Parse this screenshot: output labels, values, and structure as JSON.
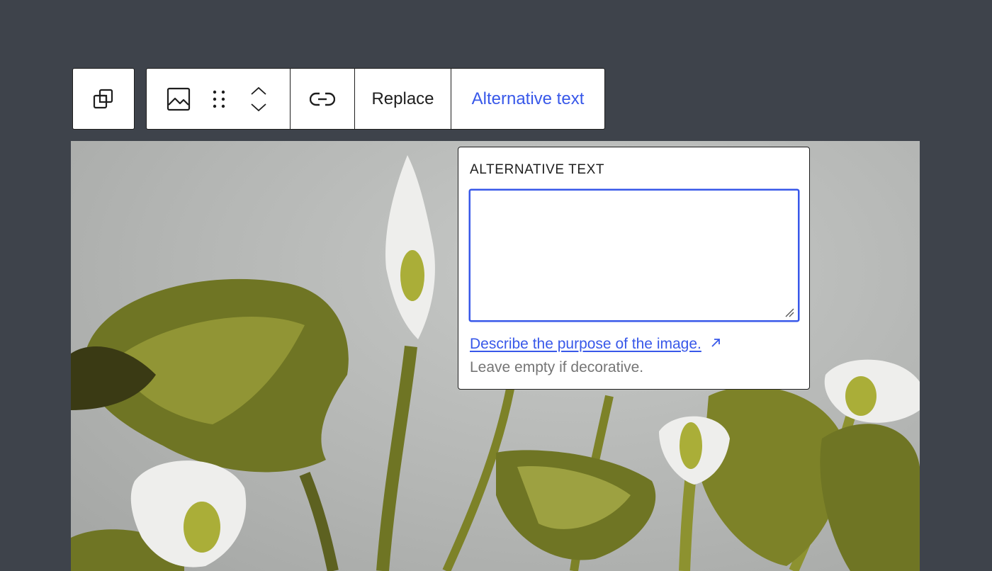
{
  "toolbar": {
    "groups": [
      {
        "buttons": [
          {
            "icon": "duplicate-blocks-icon"
          }
        ]
      },
      {
        "buttons": [
          {
            "icon": "image-icon"
          },
          {
            "icon": "drag-handle-icon"
          },
          {
            "icon": "move-up-down-icon"
          },
          {
            "icon": "link-icon"
          },
          {
            "label": "Replace"
          },
          {
            "label": "Alternative text",
            "active": true
          }
        ]
      }
    ],
    "replace_label": "Replace",
    "alt_text_label": "Alternative text"
  },
  "popover": {
    "title": "ALTERNATIVE TEXT",
    "textarea_value": "",
    "link_text": "Describe the purpose of the image.",
    "link_icon": "external-arrow-icon",
    "help_text": "Leave empty if decorative."
  },
  "image": {
    "description_icon": "calla-lily-photo",
    "palette": {
      "background": "#b6b8b6",
      "leaf": "#6f7524",
      "leaf_light": "#a9ad48",
      "flower": "#eeeeec",
      "spadix": "#aaae38"
    }
  },
  "colors": {
    "page_bg": "#3e434b",
    "accent": "#3858e9",
    "border": "#1e1e1e",
    "muted": "#757575"
  }
}
